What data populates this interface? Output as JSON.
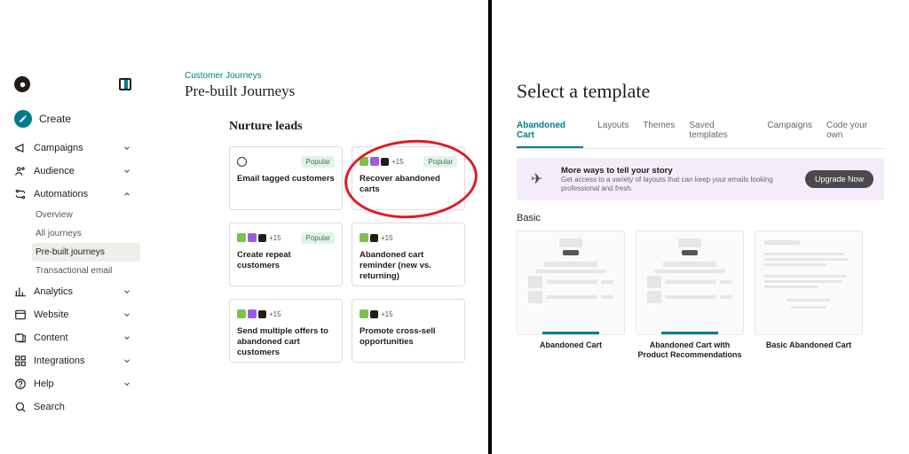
{
  "left": {
    "sidebar": {
      "create_label": "Create",
      "items": [
        {
          "label": "Campaigns",
          "icon": "megaphone"
        },
        {
          "label": "Audience",
          "icon": "people"
        },
        {
          "label": "Automations",
          "icon": "automation",
          "expanded": true,
          "sub": [
            {
              "label": "Overview"
            },
            {
              "label": "All journeys"
            },
            {
              "label": "Pre-built journeys",
              "active": true
            },
            {
              "label": "Transactional email"
            }
          ]
        },
        {
          "label": "Analytics",
          "icon": "chart"
        },
        {
          "label": "Website",
          "icon": "window"
        },
        {
          "label": "Content",
          "icon": "content"
        },
        {
          "label": "Integrations",
          "icon": "grid"
        },
        {
          "label": "Help",
          "icon": "help"
        },
        {
          "label": "Search",
          "icon": "search"
        }
      ]
    },
    "breadcrumb": "Customer Journeys",
    "page_title": "Pre-built Journeys",
    "section_title": "Nurture leads",
    "cards": [
      [
        {
          "title": "Email tagged customers",
          "icons": [
            "globe"
          ],
          "badge": "Popular"
        },
        {
          "title": "Recover abandoned carts",
          "icons": [
            "green",
            "purple",
            "dark",
            "+15"
          ],
          "badge": "Popular",
          "highlighted": true
        }
      ],
      [
        {
          "title": "Create repeat customers",
          "icons": [
            "green",
            "purple",
            "dark",
            "+15"
          ],
          "badge": "Popular"
        },
        {
          "title": "Abandoned cart reminder (new vs. returning)",
          "icons": [
            "green",
            "dark",
            "+15"
          ]
        }
      ],
      [
        {
          "title": "Send multiple offers to abandoned cart customers",
          "icons": [
            "green",
            "purple",
            "dark",
            "+15"
          ]
        },
        {
          "title": "Promote cross-sell opportunities",
          "icons": [
            "green",
            "dark",
            "+15"
          ]
        }
      ]
    ],
    "plus15": "+15"
  },
  "right": {
    "title": "Select a template",
    "tabs": [
      "Abandoned Cart",
      "Layouts",
      "Themes",
      "Saved templates",
      "Campaigns",
      "Code your own"
    ],
    "active_tab": 0,
    "promo": {
      "heading": "More ways to tell your story",
      "sub": "Get access to a variety of layouts that can keep your emails looking professional and fresh.",
      "cta": "Upgrade Now"
    },
    "section": "Basic",
    "templates": [
      {
        "label": "Abandoned Cart",
        "active_bar": true
      },
      {
        "label": "Abandoned Cart with Product Recommendations",
        "active_bar": true
      },
      {
        "label": "Basic Abandoned Cart"
      }
    ]
  }
}
